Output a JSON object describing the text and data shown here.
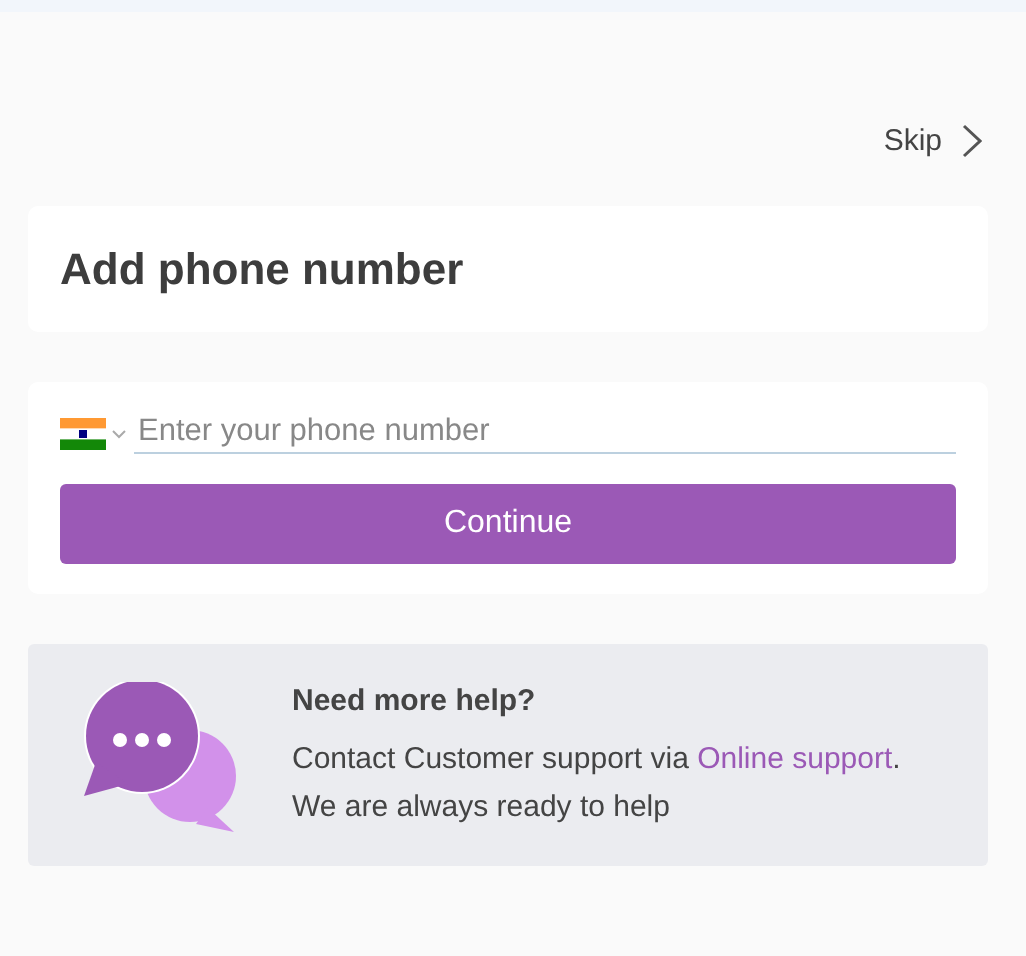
{
  "skip": {
    "label": "Skip"
  },
  "title": "Add phone number",
  "phone": {
    "placeholder": "Enter your phone number"
  },
  "continue_button": "Continue",
  "help": {
    "heading": "Need more help?",
    "text_before": "Contact Customer support via ",
    "link": "Online support",
    "text_after": ".",
    "note": "We are always ready to help"
  }
}
